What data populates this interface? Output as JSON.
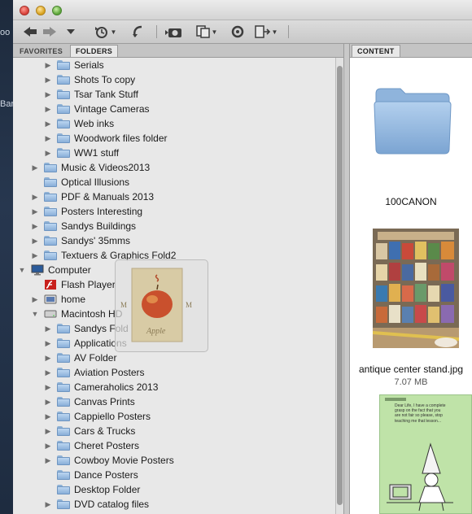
{
  "desktop": {
    "fragments": [
      "oo",
      "Bar"
    ]
  },
  "tabs": {
    "favorites": "FAVORITES",
    "folders": "FOLDERS",
    "content": "CONTENT"
  },
  "tree": [
    {
      "label": "Serials",
      "indent": 2,
      "expand": "collapsed",
      "icon": "folder"
    },
    {
      "label": "Shots To copy",
      "indent": 2,
      "expand": "collapsed",
      "icon": "folder"
    },
    {
      "label": "Tsar Tank Stuff",
      "indent": 2,
      "expand": "collapsed",
      "icon": "folder"
    },
    {
      "label": "Vintage Cameras",
      "indent": 2,
      "expand": "collapsed",
      "icon": "folder"
    },
    {
      "label": "Web inks",
      "indent": 2,
      "expand": "collapsed",
      "icon": "folder"
    },
    {
      "label": "Woodwork files folder",
      "indent": 2,
      "expand": "collapsed",
      "icon": "folder"
    },
    {
      "label": "WW1 stuff",
      "indent": 2,
      "expand": "collapsed",
      "icon": "folder"
    },
    {
      "label": "Music & Videos2013",
      "indent": 1,
      "expand": "collapsed",
      "icon": "folder"
    },
    {
      "label": "Optical Illusions",
      "indent": 1,
      "expand": "none",
      "icon": "folder"
    },
    {
      "label": "PDF & Manuals 2013",
      "indent": 1,
      "expand": "collapsed",
      "icon": "folder"
    },
    {
      "label": "Posters Interesting",
      "indent": 1,
      "expand": "collapsed",
      "icon": "folder"
    },
    {
      "label": "Sandys Buildings",
      "indent": 1,
      "expand": "collapsed",
      "icon": "folder"
    },
    {
      "label": "Sandys' 35mms",
      "indent": 1,
      "expand": "collapsed",
      "icon": "folder"
    },
    {
      "label": "Textuers & Graphics Fold2",
      "indent": 1,
      "expand": "collapsed",
      "icon": "folder"
    },
    {
      "label": "Computer",
      "indent": 0,
      "expand": "expanded",
      "icon": "computer"
    },
    {
      "label": "Flash Player",
      "indent": 1,
      "expand": "none",
      "icon": "flash"
    },
    {
      "label": "home",
      "indent": 1,
      "expand": "collapsed",
      "icon": "drive"
    },
    {
      "label": "Macintosh HD",
      "indent": 1,
      "expand": "expanded",
      "icon": "hd"
    },
    {
      "label": "Sandys Fold",
      "indent": 2,
      "expand": "collapsed",
      "icon": "folder"
    },
    {
      "label": "Applications",
      "indent": 2,
      "expand": "collapsed",
      "icon": "apps"
    },
    {
      "label": "AV Folder",
      "indent": 2,
      "expand": "collapsed",
      "icon": "folder"
    },
    {
      "label": "Aviation Posters",
      "indent": 2,
      "expand": "collapsed",
      "icon": "folder"
    },
    {
      "label": "Cameraholics 2013",
      "indent": 2,
      "expand": "collapsed",
      "icon": "folder"
    },
    {
      "label": "Canvas Prints",
      "indent": 2,
      "expand": "collapsed",
      "icon": "folder"
    },
    {
      "label": "Cappiello Posters",
      "indent": 2,
      "expand": "collapsed",
      "icon": "folder"
    },
    {
      "label": "Cars & Trucks",
      "indent": 2,
      "expand": "collapsed",
      "icon": "folder"
    },
    {
      "label": "Cheret Posters",
      "indent": 2,
      "expand": "collapsed",
      "icon": "folder"
    },
    {
      "label": "Cowboy Movie Posters",
      "indent": 2,
      "expand": "collapsed",
      "icon": "folder"
    },
    {
      "label": "Dance Posters",
      "indent": 2,
      "expand": "none",
      "icon": "folder"
    },
    {
      "label": "Desktop Folder",
      "indent": 2,
      "expand": "none",
      "icon": "folder"
    },
    {
      "label": "DVD catalog files",
      "indent": 2,
      "expand": "collapsed",
      "icon": "folder"
    }
  ],
  "content_items": [
    {
      "name": "100CANON",
      "kind": "folder"
    },
    {
      "name": "antique center stand.jpg",
      "size": "7.07 MB",
      "kind": "photo"
    },
    {
      "name": "",
      "kind": "cartoon",
      "caption": "Dear Life, I have a complete grasp on the fact that you are not fair so please, stop teaching me that lesson..."
    }
  ],
  "drag_preview": {
    "apple_word": "Apple",
    "letter_m": "M"
  },
  "colors": {
    "folder_blue": "#89afd8",
    "window_bg": "#e8e8e8",
    "cartoon_green": "#bfe3a8"
  }
}
